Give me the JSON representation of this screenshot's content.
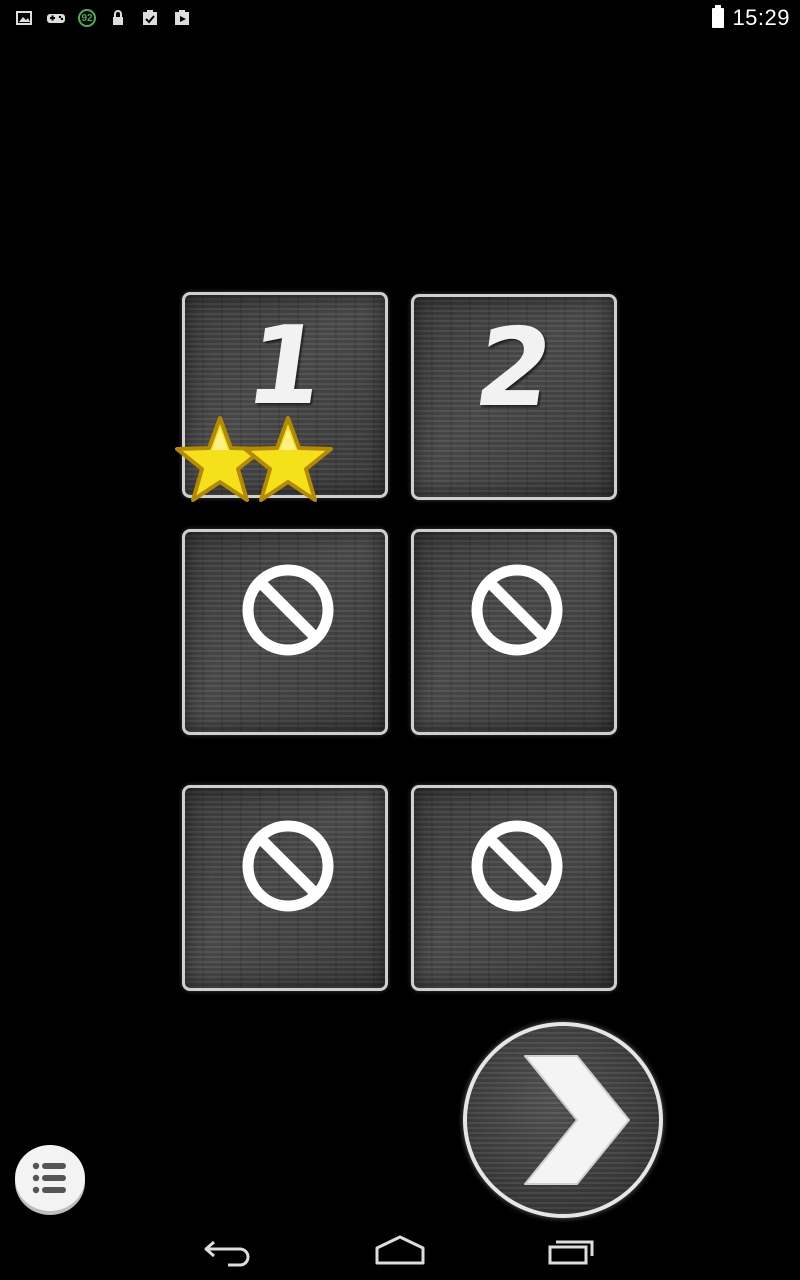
{
  "status_bar": {
    "time": "15:29",
    "notification_icons": [
      "image-icon",
      "game-controller-icon",
      "badge-icon",
      "lock-icon",
      "clipboard-check-icon",
      "media-play-icon"
    ],
    "badge_value": "92",
    "badge_color": "#4caf50"
  },
  "levels": [
    {
      "number": "1",
      "locked": false,
      "stars": 2
    },
    {
      "number": "2",
      "locked": false,
      "stars": 0
    },
    {
      "number": "",
      "locked": true,
      "stars": 0
    },
    {
      "number": "",
      "locked": true,
      "stars": 0
    },
    {
      "number": "",
      "locked": true,
      "stars": 0
    },
    {
      "number": "",
      "locked": true,
      "stars": 0
    }
  ],
  "buttons": {
    "next_icon": "chevron-right-icon",
    "menu_icon": "list-menu-icon"
  },
  "nav_bar": {
    "icons": [
      "back-icon",
      "home-icon",
      "recent-apps-icon"
    ]
  },
  "colors": {
    "background": "#000000",
    "tile_border": "#cfcfcf",
    "star_fill": "#f5e11a",
    "star_stroke": "#b38a00"
  }
}
